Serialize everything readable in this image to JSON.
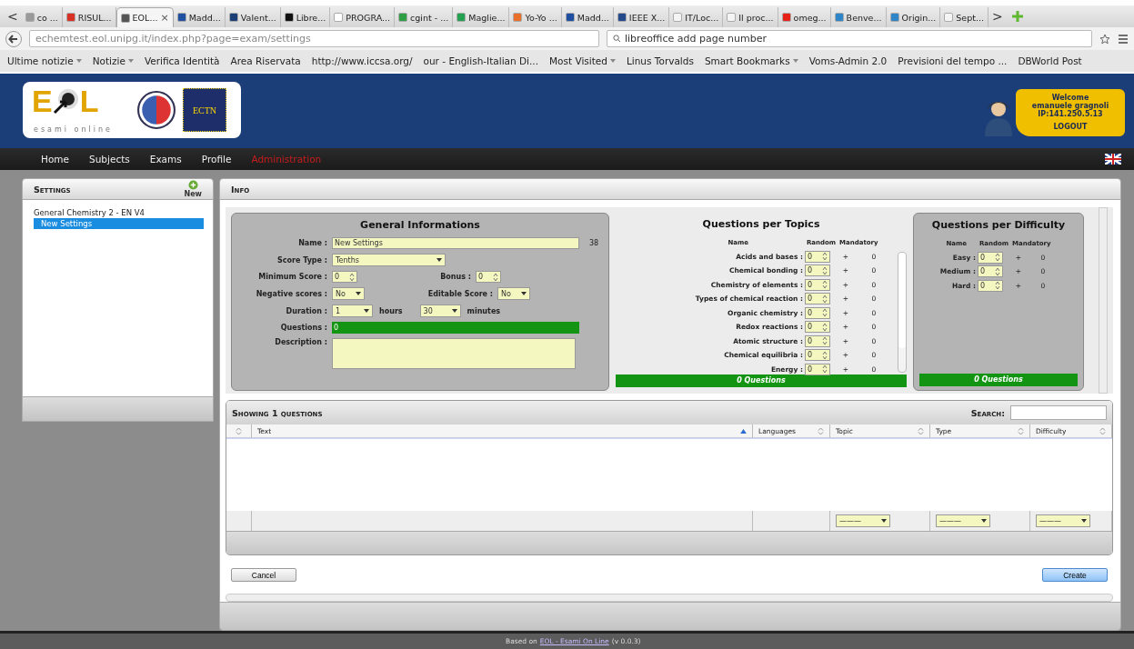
{
  "browser": {
    "tabs": [
      {
        "label": "co ...",
        "color": "#9a9a9a",
        "selected": false
      },
      {
        "label": "RISUL...",
        "color": "#d93025",
        "selected": false
      },
      {
        "label": "EOL...",
        "color": "#555555",
        "selected": true,
        "close": "×"
      },
      {
        "label": "Madd...",
        "color": "#1e4fa0",
        "selected": false
      },
      {
        "label": "Valent...",
        "color": "#1c3f78",
        "selected": false
      },
      {
        "label": "Libre...",
        "color": "#111111",
        "selected": false
      },
      {
        "label": "PROGRA...",
        "color": "#ffffff",
        "selected": false
      },
      {
        "label": "cgint - ...",
        "color": "#2f9e44",
        "selected": false
      },
      {
        "label": "Maglie...",
        "color": "#23a050",
        "selected": false
      },
      {
        "label": "Yo-Yo ...",
        "color": "#e8702a",
        "selected": false
      },
      {
        "label": "Madd...",
        "color": "#1e4fa0",
        "selected": false
      },
      {
        "label": "IEEE X...",
        "color": "#244a8c",
        "selected": false
      },
      {
        "label": "IT/Loc...",
        "color": "#f4f4f4",
        "selected": false
      },
      {
        "label": "Il proc...",
        "color": "#f4f4f4",
        "selected": false
      },
      {
        "label": "omeg...",
        "color": "#e62117",
        "selected": false
      },
      {
        "label": "Benve...",
        "color": "#2e86c8",
        "selected": false
      },
      {
        "label": "Origin...",
        "color": "#2e86c8",
        "selected": false
      },
      {
        "label": "Sept...",
        "color": "#f4f4f4",
        "selected": false
      }
    ],
    "scroll_left": "<",
    "scroll_right": ">",
    "url": "echemtest.eol.unipg.it/index.php?page=exam/settings",
    "search": "libreoffice add page number",
    "bookmarks": [
      {
        "label": "Ultime notizie",
        "menu": true
      },
      {
        "label": "Notizie",
        "menu": true
      },
      {
        "label": "Verifica Identità",
        "menu": false
      },
      {
        "label": "Area Riservata",
        "menu": false
      },
      {
        "label": "http://www.iccsa.org/",
        "menu": false
      },
      {
        "label": "our - English-Italian Di...",
        "menu": false
      },
      {
        "label": "Most Visited",
        "menu": true
      },
      {
        "label": "Linus Torvalds",
        "menu": false
      },
      {
        "label": "Smart Bookmarks",
        "menu": true
      },
      {
        "label": "Voms-Admin 2.0",
        "menu": false
      },
      {
        "label": "Previsioni del tempo ...",
        "menu": false
      },
      {
        "label": "DBWorld Post",
        "menu": false
      }
    ]
  },
  "header": {
    "logo_letters": [
      "E",
      "L"
    ],
    "tagline": "esami online",
    "badge": "ECTN",
    "user": {
      "greeting": "Welcome",
      "name": "emanuele gragnoli",
      "ip": "IP:141.250.5.13",
      "logout": "LOGOUT"
    }
  },
  "nav": [
    {
      "label": "Home",
      "selected": false
    },
    {
      "label": "Subjects",
      "selected": false
    },
    {
      "label": "Exams",
      "selected": false
    },
    {
      "label": "Profile",
      "selected": false
    },
    {
      "label": "Administration",
      "selected": true
    }
  ],
  "sidebar": {
    "title": "Settings",
    "new_button": "New",
    "tree": [
      {
        "label": "General Chemistry 2 - EN V4",
        "selected": false,
        "children": [
          {
            "label": "New Settings",
            "selected": true
          }
        ]
      }
    ]
  },
  "info": {
    "title": "Info"
  },
  "general": {
    "title": "General Informations",
    "name": {
      "label": "Name :",
      "value": "New Settings",
      "counter": "38"
    },
    "score_type": {
      "label": "Score Type :",
      "value": "Tenths"
    },
    "minimum_score": {
      "label": "Minimum Score :",
      "value": "0"
    },
    "bonus": {
      "label": "Bonus :",
      "value": "0"
    },
    "negative_scores": {
      "label": "Negative scores :",
      "value": "No"
    },
    "editable_score": {
      "label": "Editable Score :",
      "value": "No"
    },
    "duration": {
      "label": "Duration :",
      "hours": "1",
      "hours_unit": "hours",
      "minutes": "30",
      "minutes_unit": "minutes"
    },
    "questions": {
      "label": "Questions :",
      "value": "0"
    },
    "description": {
      "label": "Description :"
    }
  },
  "topics": {
    "title": "Questions per Topics",
    "columns": [
      "Name",
      "Random",
      "Mandatory"
    ],
    "rows": [
      {
        "name": "Acids and bases :",
        "random": "0",
        "plus": "+",
        "mandatory": "0"
      },
      {
        "name": "Chemical bonding :",
        "random": "0",
        "plus": "+",
        "mandatory": "0"
      },
      {
        "name": "Chemistry of elements :",
        "random": "0",
        "plus": "+",
        "mandatory": "0"
      },
      {
        "name": "Types of chemical reaction :",
        "random": "0",
        "plus": "+",
        "mandatory": "0"
      },
      {
        "name": "Organic chemistry :",
        "random": "0",
        "plus": "+",
        "mandatory": "0"
      },
      {
        "name": "Redox reactions :",
        "random": "0",
        "plus": "+",
        "mandatory": "0"
      },
      {
        "name": "Atomic structure :",
        "random": "0",
        "plus": "+",
        "mandatory": "0"
      },
      {
        "name": "Chemical equilibria :",
        "random": "0",
        "plus": "+",
        "mandatory": "0"
      },
      {
        "name": "Energy :",
        "random": "0",
        "plus": "+",
        "mandatory": "0"
      }
    ],
    "total": "0 Questions"
  },
  "difficulty": {
    "title": "Questions per Difficulty",
    "columns": [
      "Name",
      "Random",
      "Mandatory"
    ],
    "rows": [
      {
        "name": "Easy :",
        "random": "0",
        "plus": "+",
        "mandatory": "0"
      },
      {
        "name": "Medium :",
        "random": "0",
        "plus": "+",
        "mandatory": "0"
      },
      {
        "name": "Hard :",
        "random": "0",
        "plus": "+",
        "mandatory": "0"
      }
    ],
    "total": "0 Questions"
  },
  "questions_table": {
    "title": "Showing 1 questions",
    "search_label": "Search:",
    "columns": [
      {
        "sorted": false,
        "filter": false
      },
      {
        "label": "Text",
        "sorted": true,
        "filter": false
      },
      {
        "label": "Languages",
        "sorted": false,
        "filter": false
      },
      {
        "label": "Topic",
        "sorted": false,
        "filter": true
      },
      {
        "label": "Type",
        "sorted": false,
        "filter": true
      },
      {
        "label": "Difficulty",
        "sorted": false,
        "filter": true
      }
    ],
    "filter_value": "———"
  },
  "buttons": {
    "cancel": "Cancel",
    "create": "Create"
  },
  "footer": {
    "prefix": "Based on",
    "link": "EOL - Esami On Line",
    "version": "(v 0.0.3)"
  }
}
